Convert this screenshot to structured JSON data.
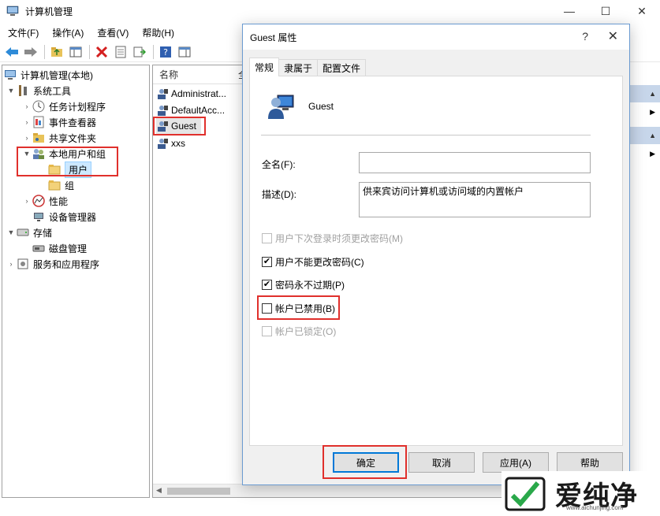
{
  "main_window": {
    "title": "计算机管理",
    "controls": {
      "minimize": "—",
      "maximize": "☐",
      "close": "✕"
    }
  },
  "menu": [
    "文件(F)",
    "操作(A)",
    "查看(V)",
    "帮助(H)"
  ],
  "tree": {
    "root": "计算机管理(本地)",
    "items": [
      {
        "label": "系统工具",
        "icon": "tools-icon",
        "expanded": true
      },
      {
        "label": "任务计划程序",
        "icon": "clock-icon"
      },
      {
        "label": "事件查看器",
        "icon": "event-viewer-icon"
      },
      {
        "label": "共享文件夹",
        "icon": "shared-folder-icon"
      },
      {
        "label": "本地用户和组",
        "icon": "users-group-icon",
        "expanded": true
      },
      {
        "label": "用户",
        "icon": "folder-icon",
        "selected": true
      },
      {
        "label": "组",
        "icon": "folder-icon"
      },
      {
        "label": "性能",
        "icon": "performance-icon"
      },
      {
        "label": "设备管理器",
        "icon": "device-manager-icon"
      },
      {
        "label": "存储",
        "icon": "storage-icon",
        "expanded": true
      },
      {
        "label": "磁盘管理",
        "icon": "disk-icon"
      },
      {
        "label": "服务和应用程序",
        "icon": "services-icon"
      }
    ]
  },
  "list": {
    "header_name": "名称",
    "header_fullname": "全",
    "rows": [
      "Administrat...",
      "DefaultAcc...",
      "Guest",
      "xxs"
    ]
  },
  "dialog": {
    "title": "Guest 属性",
    "help": "?",
    "close": "✕",
    "tabs": [
      "常规",
      "隶属于",
      "配置文件"
    ],
    "username": "Guest",
    "fullname_label": "全名(F):",
    "fullname_value": "",
    "description_label": "描述(D):",
    "description_value": "供来宾访问计算机或访问域的内置帐户",
    "checkboxes": [
      {
        "label": "用户下次登录时须更改密码(M)",
        "checked": false,
        "disabled": true
      },
      {
        "label": "用户不能更改密码(C)",
        "checked": true,
        "disabled": false
      },
      {
        "label": "密码永不过期(P)",
        "checked": true,
        "disabled": false
      },
      {
        "label": "帐户已禁用(B)",
        "checked": false,
        "disabled": false
      },
      {
        "label": "帐户已锁定(O)",
        "checked": false,
        "disabled": true
      }
    ],
    "buttons": {
      "ok": "确定",
      "cancel": "取消",
      "apply": "应用(A)",
      "help": "帮助"
    }
  },
  "watermark": {
    "brand": "爱纯净",
    "url": "www.aichunjing.com"
  },
  "colors": {
    "highlight_red": "#e0302c",
    "selection_blue": "#cce8ff",
    "dialog_border": "#6b9bd1"
  }
}
